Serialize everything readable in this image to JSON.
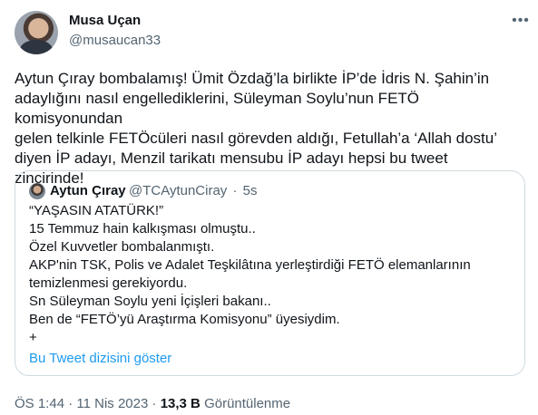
{
  "author": {
    "name": "Musa Uçan",
    "handle": "@musaucan33"
  },
  "tweet": {
    "text": "Aytun Çıray bombalamış! Ümit Özdağ’la birlikte İP’de İdris N. Şahin’in\nadaylığını nasıl engellediklerini, Süleyman Soylu’nun FETÖ komisyonundan\ngelen telkinle FETÖcüleri nasıl görevden aldığı, Fetullah’a ‘Allah dostu’\ndiyen İP adayı, Menzil tarikatı mensubu İP adayı hepsi bu tweet\nzincirinde!"
  },
  "quote": {
    "name": "Aytun Çıray",
    "handle": "@TCAytunCiray",
    "separator": "·",
    "time": "5s",
    "lines": [
      "“YAŞASIN ATATÜRK!”",
      "15 Temmuz hain kalkışması olmuştu..",
      "Özel Kuvvetler bombalanmıştı.",
      "AKP'nin TSK, Polis ve Adalet Teşkilâtına yerleştirdiği FETÖ elemanlarının",
      "temizlenmesi gerekiyordu.",
      "Sn Süleyman Soylu yeni İçişleri bakanı..",
      "Ben de “FETÖ’yü Araştırma Komisyonu” üyesiydim.",
      "+"
    ],
    "thread_link": "Bu Tweet dizisini göster"
  },
  "footer": {
    "time": "ÖS 1:44",
    "separator1": "·",
    "date": "11 Nis 2023",
    "separator2": "·",
    "views_count": "13,3 B",
    "views_label": "Görüntülenme"
  },
  "icons": {
    "more": "more-horizontal-icon"
  },
  "colors": {
    "text": "#0f1419",
    "secondary": "#536471",
    "link": "#1d9bf0",
    "border": "#cfd9de"
  }
}
